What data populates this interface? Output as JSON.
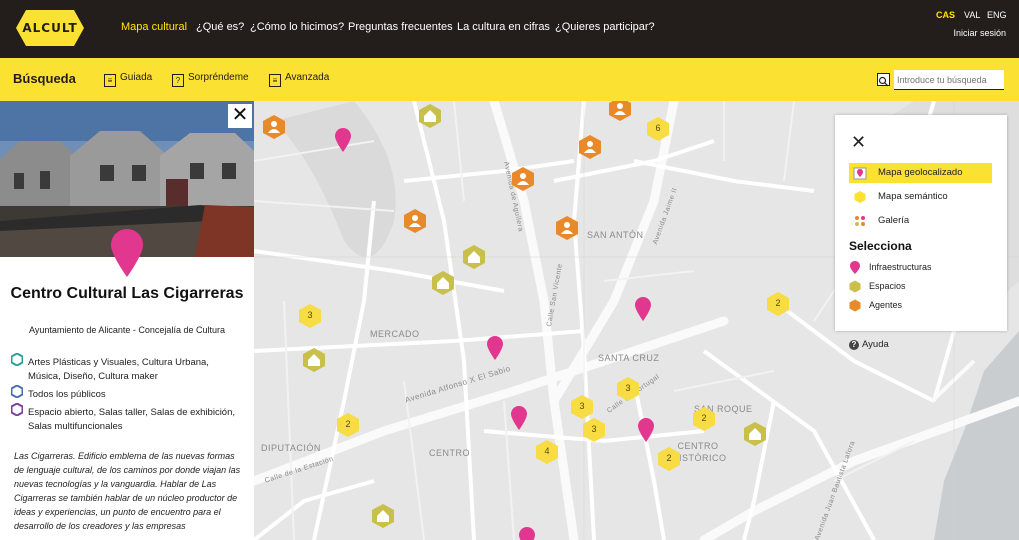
{
  "header": {
    "logo_text": "ALCULT",
    "nav": [
      "Mapa cultural",
      "¿Qué es?",
      "¿Cómo lo hicimos?",
      "Preguntas frecuentes",
      "La cultura en cifras",
      "¿Quieres participar?"
    ],
    "languages": [
      "CAS",
      "VAL",
      "ENG"
    ],
    "login": "Iniciar sesión"
  },
  "search": {
    "title": "Búsqueda",
    "tabs": [
      "Guiada",
      "Sorpréndeme",
      "Avanzada"
    ],
    "placeholder": "Introduce tu búsqueda"
  },
  "place": {
    "title": "Centro Cultural Las Cigarreras",
    "subtitle": "Ayuntamiento de Alicante - Concejalía de Cultura",
    "features": [
      "Artes Plásticas y Visuales, Cultura Urbana, Música, Diseño, Cultura maker",
      "Todos los públicos",
      "Espacio abierto, Salas taller, Salas de exhibición, Salas multifuncionales"
    ],
    "description": "Las Cigarreras. Edificio emblema de las nuevas formas de lenguaje cultural, de los caminos por donde viajan las nuevas tecnologías y la vanguardia. Hablar de Las Cigarreras se también hablar de un núcleo productor de ideas y experiencias, un punto de encuentro para el desarrollo de los creadores y las empresas"
  },
  "map": {
    "labels": [
      "SAN ANTÓN",
      "MERCADO",
      "SANTA CRUZ",
      "SAN ROQUE",
      "CENTRO HISTÓRICO",
      "DIPUTACIÓN",
      "CENTRO",
      "Avenida Alfonso X El Sabio",
      "Calle San Vicente",
      "Avenida Jaime II",
      "Avenida de Aguilera",
      "Avenida Juan Bautista Lafora",
      "Calle de Portugal",
      "Calle de la Estación"
    ],
    "cluster_counts": [
      "6",
      "2",
      "3",
      "2",
      "3",
      "3",
      "3",
      "2",
      "4",
      "2"
    ]
  },
  "legend": {
    "views": [
      "Mapa geolocalizado",
      "Mapa semántico",
      "Galería"
    ],
    "active_view": "Mapa geolocalizado",
    "heading": "Selecciona",
    "layers": [
      "Infraestructuras",
      "Espacios",
      "Agentes"
    ],
    "help": "Ayuda"
  },
  "colors": {
    "brand_yellow": "#fbe232",
    "header_dark": "#231e1b",
    "infra_pink": "#e2378f",
    "espacios_olive": "#c8c04a",
    "agentes_orange": "#e98a2a",
    "cluster_yellow": "#f7dc43"
  }
}
